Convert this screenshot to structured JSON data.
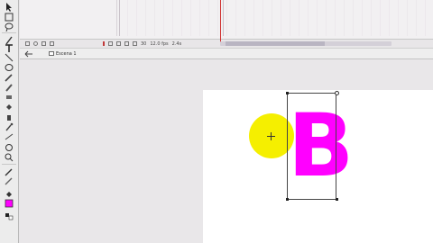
{
  "timeline": {
    "frame_number": "30",
    "frame_rate": "12.0 fps",
    "elapsed_time": "2.4s"
  },
  "editbar": {
    "scene_label": "Escena 1"
  },
  "stage": {
    "text_content": "B",
    "text_color": "#ff00ff",
    "circle_color": "#f5ef00"
  },
  "tools": [
    "arrow-icon",
    "subselect-icon",
    "lasso-icon",
    "text-icon",
    "line-icon",
    "oval-icon",
    "pencil-icon",
    "brush-icon",
    "eraser-icon",
    "paint-bucket-icon",
    "eyedropper-icon",
    "ink-bottle-icon",
    "hand-icon",
    "zoom-icon",
    "stroke-color-icon",
    "fill-color-icon"
  ]
}
